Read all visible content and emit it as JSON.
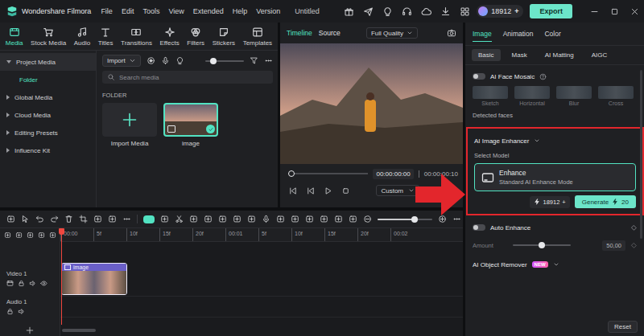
{
  "titlebar": {
    "app_name": "Wondershare Filmora",
    "menu": [
      "File",
      "Edit",
      "Tools",
      "View",
      "Extended",
      "Help",
      "Version"
    ],
    "project": "Untitled",
    "credits": "18912",
    "credits_add": "+",
    "export": "Export"
  },
  "toolbar": [
    {
      "label": "Media",
      "selected": true
    },
    {
      "label": "Stock Media",
      "selected": false
    },
    {
      "label": "Audio",
      "selected": false
    },
    {
      "label": "Titles",
      "selected": false
    },
    {
      "label": "Transitions",
      "selected": false
    },
    {
      "label": "Effects",
      "selected": false
    },
    {
      "label": "Filters",
      "selected": false
    },
    {
      "label": "Stickers",
      "selected": false
    },
    {
      "label": "Templates",
      "selected": false
    }
  ],
  "sidebar": [
    {
      "label": "Project Media",
      "expanded": true,
      "selected": true,
      "children": [
        {
          "label": "Folder",
          "selected": true
        }
      ]
    },
    {
      "label": "Global Media",
      "expanded": false,
      "selected": false,
      "children": []
    },
    {
      "label": "Cloud Media",
      "expanded": false,
      "selected": false,
      "children": []
    },
    {
      "label": "Editing Presets",
      "expanded": false,
      "selected": false,
      "children": []
    },
    {
      "label": "Influence Kit",
      "expanded": false,
      "selected": false,
      "children": []
    }
  ],
  "media": {
    "import": "Import",
    "zoom_level": 0.2,
    "search_placeholder": "Search media",
    "section": "FOLDER",
    "tiles": [
      {
        "label": "Import Media",
        "kind": "import",
        "selected": false
      },
      {
        "label": "image",
        "kind": "image",
        "selected": true
      }
    ]
  },
  "preview": {
    "tabs": [
      {
        "label": "Timeline",
        "selected": true
      },
      {
        "label": "Source",
        "selected": false
      }
    ],
    "quality": "Full Quality",
    "progress": 0,
    "time": "00:00:00:00",
    "duration": "00:00:00:10",
    "zoom": "Custom"
  },
  "timeline": {
    "ruler": [
      "00:00",
      "5f",
      "10f",
      "15f",
      "20f",
      "00:01",
      "5f",
      "10f",
      "15f",
      "20f",
      "00:02"
    ],
    "playhead": 0,
    "zoom_level": 0.68,
    "tracks": [
      {
        "name": "Video 1",
        "kind": "video",
        "clips": [
          {
            "label": "image",
            "selected": true
          }
        ]
      },
      {
        "name": "Audio 1",
        "kind": "audio",
        "clips": []
      }
    ]
  },
  "properties": {
    "tabs": [
      {
        "label": "Image",
        "selected": true
      },
      {
        "label": "Animation",
        "selected": false
      },
      {
        "label": "Color",
        "selected": false
      }
    ],
    "subtabs": [
      {
        "label": "Basic",
        "selected": true
      },
      {
        "label": "Mask",
        "selected": false
      },
      {
        "label": "AI Matting",
        "selected": false
      },
      {
        "label": "AIGC",
        "selected": false
      }
    ],
    "face_mosaic": {
      "title": "AI Face Mosaic",
      "on": false,
      "styles": [
        "Sketch",
        "Horizontal",
        "Blur",
        "Cross"
      ],
      "detected": "Detected faces"
    },
    "enhancer": {
      "title": "AI Image Enhancer",
      "highlighted": true,
      "select_label": "Select Model",
      "models": [
        {
          "name": "Enhance",
          "description": "Standard AI Enhance Mode",
          "selected": true
        }
      ],
      "credits": "18912",
      "credits_add": "+",
      "generate": "Generate",
      "cost": "20"
    },
    "auto_enhance": {
      "title": "Auto Enhance",
      "on": false,
      "amount_label": "Amount",
      "level": 0.5,
      "reading": "50,00"
    },
    "object_remover": {
      "title": "AI Object Remover",
      "badge": "NEW"
    },
    "reset": "Reset"
  }
}
